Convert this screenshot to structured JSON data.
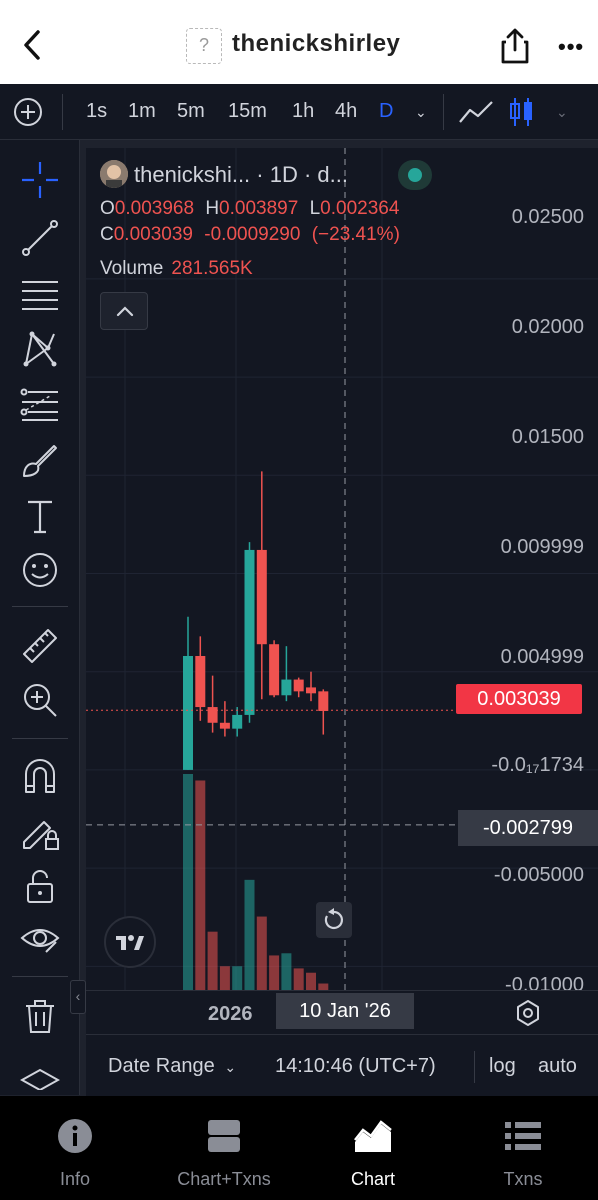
{
  "header": {
    "title": "thenickshirley",
    "avatar_placeholder": "?"
  },
  "toolbar": {
    "timeframes": [
      "1s",
      "1m",
      "5m",
      "15m",
      "1h",
      "4h",
      "D"
    ],
    "active_timeframe": "D"
  },
  "legend": {
    "symbol": "thenickshi... · 1D · d...",
    "o_label": "O",
    "o": "0.003968",
    "h_label": "H",
    "h": "0.003897",
    "l_label": "L",
    "l": "0.002364",
    "c_label": "C",
    "c": "0.003039",
    "change": "-0.0009290",
    "change_pct": "(−23.41%)",
    "volume_label": "Volume",
    "volume": "281.565K"
  },
  "price_axis": {
    "labels": [
      "0.02500",
      "0.02000",
      "0.01500",
      "0.009999",
      "0.004999",
      "-0.0₁₇1734",
      "-0.005000",
      "-0.01000"
    ],
    "current_price": "0.003039",
    "crosshair_price": "-0.002799"
  },
  "time_axis": {
    "year": "2026",
    "crosshair_date": "10 Jan '26"
  },
  "bottom_bar": {
    "date_range": "Date Range",
    "clock": "14:10:46 (UTC+7)",
    "log": "log",
    "auto": "auto"
  },
  "nav": {
    "items": [
      {
        "label": "Info",
        "icon": "info-icon"
      },
      {
        "label": "Chart+Txns",
        "icon": "split-icon"
      },
      {
        "label": "Chart",
        "icon": "chart-icon"
      },
      {
        "label": "Txns",
        "icon": "list-icon"
      }
    ],
    "active": "Chart"
  },
  "colors": {
    "up": "#26a69a",
    "down": "#ef5350",
    "accent": "#2962ff",
    "background": "#131722"
  },
  "chart_data": {
    "type": "candlestick",
    "candles": [
      {
        "o": 0.0,
        "h": 0.0078,
        "l": 0.0,
        "c": 0.0058
      },
      {
        "o": 0.0058,
        "h": 0.0068,
        "l": 0.0025,
        "c": 0.0032
      },
      {
        "o": 0.0032,
        "h": 0.0048,
        "l": 0.0019,
        "c": 0.0024
      },
      {
        "o": 0.0024,
        "h": 0.0035,
        "l": 0.0017,
        "c": 0.0021
      },
      {
        "o": 0.0021,
        "h": 0.0032,
        "l": 0.0017,
        "c": 0.0028
      },
      {
        "o": 0.0028,
        "h": 0.0116,
        "l": 0.0024,
        "c": 0.0112
      },
      {
        "o": 0.0112,
        "h": 0.0152,
        "l": 0.0036,
        "c": 0.0064
      },
      {
        "o": 0.0064,
        "h": 0.0066,
        "l": 0.0037,
        "c": 0.0038
      },
      {
        "o": 0.0038,
        "h": 0.0063,
        "l": 0.0035,
        "c": 0.0046
      },
      {
        "o": 0.0046,
        "h": 0.0047,
        "l": 0.0037,
        "c": 0.004
      },
      {
        "o": 0.0042,
        "h": 0.005,
        "l": 0.0035,
        "c": 0.0039
      },
      {
        "o": 0.004,
        "h": 0.0041,
        "l": 0.0018,
        "c": 0.003
      }
    ],
    "volumes": [
      {
        "v": 100,
        "dir": "up"
      },
      {
        "v": 97,
        "dir": "down"
      },
      {
        "v": 27,
        "dir": "down"
      },
      {
        "v": 11,
        "dir": "down"
      },
      {
        "v": 11,
        "dir": "up"
      },
      {
        "v": 51,
        "dir": "up"
      },
      {
        "v": 34,
        "dir": "down"
      },
      {
        "v": 16,
        "dir": "down"
      },
      {
        "v": 17,
        "dir": "up"
      },
      {
        "v": 10,
        "dir": "down"
      },
      {
        "v": 8,
        "dir": "down"
      },
      {
        "v": 3,
        "dir": "down"
      }
    ],
    "ylim": [
      -0.0109,
      0.0281
    ],
    "y_ticks": [
      0.025,
      0.02,
      0.015,
      0.009999,
      0.004999,
      0.0,
      -0.005,
      -0.01
    ],
    "current_price": 0.003039,
    "crosshair_price": -0.002799,
    "crosshair_date": "10 Jan '26"
  }
}
